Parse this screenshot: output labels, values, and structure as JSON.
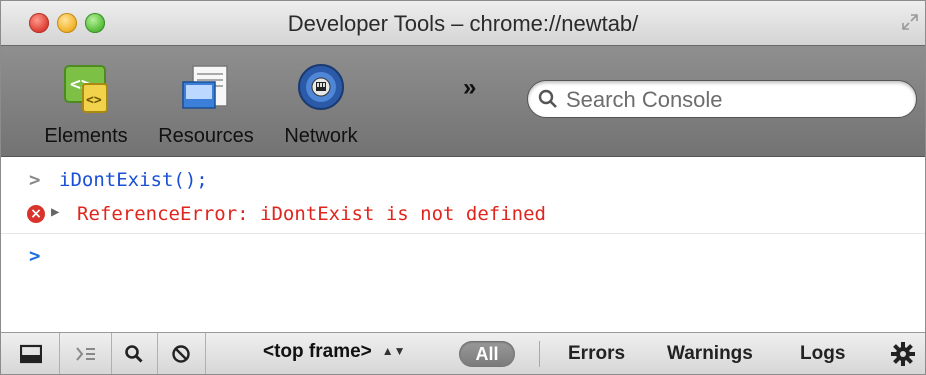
{
  "window": {
    "title": "Developer Tools – chrome://newtab/"
  },
  "toolbar": {
    "tools": [
      {
        "label": "Elements",
        "icon": "elements-icon"
      },
      {
        "label": "Resources",
        "icon": "resources-icon"
      },
      {
        "label": "Network",
        "icon": "network-icon"
      }
    ],
    "overflow_label": "»",
    "search_placeholder": "Search Console"
  },
  "console": {
    "prompt_glyph": ">",
    "input_line": "iDontExist();",
    "error_message": "ReferenceError: iDontExist is not defined",
    "error_icon_glyph": "×",
    "expand_glyph": "▶"
  },
  "statusbar": {
    "frame_selector": "<top frame>",
    "frame_arrows": "▲▼",
    "filters": {
      "all": "All",
      "errors": "Errors",
      "warnings": "Warnings",
      "logs": "Logs"
    }
  },
  "colors": {
    "error_red": "#e0251e",
    "input_blue": "#1a4fd6",
    "prompt_blue": "#1a6ee0",
    "toolbar_gray": "#7f7f7f"
  }
}
